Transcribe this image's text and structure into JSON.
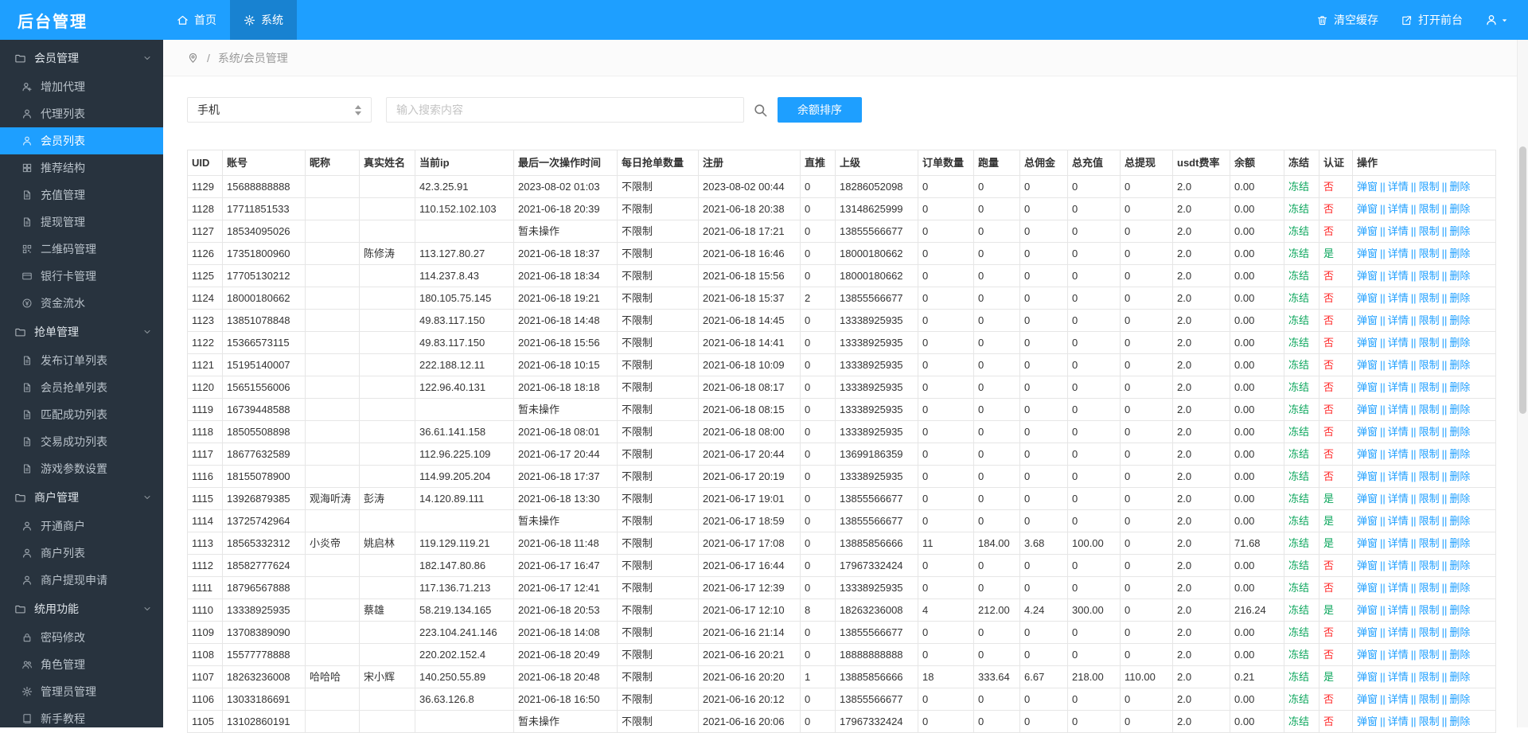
{
  "header": {
    "logo": "后台管理",
    "tabs": [
      {
        "label": "首页",
        "icon": "home",
        "active": false
      },
      {
        "label": "系统",
        "icon": "gear",
        "active": true
      }
    ],
    "actions": [
      {
        "label": "清空缓存",
        "icon": "trash"
      },
      {
        "label": "打开前台",
        "icon": "external"
      }
    ]
  },
  "sidebar": {
    "active_item": "会员列表",
    "sections": [
      {
        "label": "会员管理",
        "items": [
          {
            "label": "增加代理",
            "icon": "person-add"
          },
          {
            "label": "代理列表",
            "icon": "person"
          },
          {
            "label": "会员列表",
            "icon": "person"
          },
          {
            "label": "推荐结构",
            "icon": "grid"
          },
          {
            "label": "充值管理",
            "icon": "doc"
          },
          {
            "label": "提现管理",
            "icon": "doc"
          },
          {
            "label": "二维码管理",
            "icon": "qr"
          },
          {
            "label": "银行卡管理",
            "icon": "card"
          },
          {
            "label": "资金流水",
            "icon": "coin"
          }
        ]
      },
      {
        "label": "抢单管理",
        "items": [
          {
            "label": "发布订单列表",
            "icon": "doc"
          },
          {
            "label": "会员抢单列表",
            "icon": "doc"
          },
          {
            "label": "匹配成功列表",
            "icon": "doc"
          },
          {
            "label": "交易成功列表",
            "icon": "doc"
          },
          {
            "label": "游戏参数设置",
            "icon": "doc"
          }
        ]
      },
      {
        "label": "商户管理",
        "items": [
          {
            "label": "开通商户",
            "icon": "person"
          },
          {
            "label": "商户列表",
            "icon": "person"
          },
          {
            "label": "商户提现申请",
            "icon": "person"
          }
        ]
      },
      {
        "label": "统用功能",
        "items": [
          {
            "label": "密码修改",
            "icon": "lock"
          },
          {
            "label": "角色管理",
            "icon": "users"
          },
          {
            "label": "管理员管理",
            "icon": "gear"
          },
          {
            "label": "新手教程",
            "icon": "book"
          }
        ]
      }
    ]
  },
  "breadcrumb": {
    "separator": "/",
    "path": "系统/会员管理"
  },
  "toolbar": {
    "filter_selected": "手机",
    "search_placeholder": "输入搜索内容",
    "sort_button": "余额排序"
  },
  "table": {
    "columns": [
      "UID",
      "账号",
      "昵称",
      "真实姓名",
      "当前ip",
      "最后一次操作时间",
      "每日抢单数量",
      "注册",
      "直推",
      "上级",
      "订单数量",
      "跑量",
      "总佣金",
      "总充值",
      "总提现",
      "usdt费率",
      "余额",
      "冻结",
      "认证",
      "操作"
    ],
    "freeze_label": "冻结",
    "verified_yes": "是",
    "verified_no": "否",
    "operations": [
      "弹窗",
      "详情",
      "限制",
      "删除"
    ],
    "op_separator": "||",
    "rows": [
      [
        "1129",
        "15688888888",
        "",
        "",
        "42.3.25.91",
        "2023-08-02 01:03",
        "不限制",
        "2023-08-02 00:44",
        "0",
        "18286052098",
        "0",
        "0",
        "0",
        "0",
        "0",
        "2.0",
        "0.00",
        "否"
      ],
      [
        "1128",
        "17711851533",
        "",
        "",
        "110.152.102.103",
        "2021-06-18 20:39",
        "不限制",
        "2021-06-18 20:38",
        "0",
        "13148625999",
        "0",
        "0",
        "0",
        "0",
        "0",
        "2.0",
        "0.00",
        "否"
      ],
      [
        "1127",
        "18534095026",
        "",
        "",
        "",
        "暂未操作",
        "不限制",
        "2021-06-18 17:21",
        "0",
        "13855566677",
        "0",
        "0",
        "0",
        "0",
        "0",
        "2.0",
        "0.00",
        "否"
      ],
      [
        "1126",
        "17351800960",
        "",
        "陈修涛",
        "113.127.80.27",
        "2021-06-18 18:37",
        "不限制",
        "2021-06-18 16:46",
        "0",
        "18000180662",
        "0",
        "0",
        "0",
        "0",
        "0",
        "2.0",
        "0.00",
        "是"
      ],
      [
        "1125",
        "17705130212",
        "",
        "",
        "114.237.8.43",
        "2021-06-18 18:34",
        "不限制",
        "2021-06-18 15:56",
        "0",
        "18000180662",
        "0",
        "0",
        "0",
        "0",
        "0",
        "2.0",
        "0.00",
        "否"
      ],
      [
        "1124",
        "18000180662",
        "",
        "",
        "180.105.75.145",
        "2021-06-18 19:21",
        "不限制",
        "2021-06-18 15:37",
        "2",
        "13855566677",
        "0",
        "0",
        "0",
        "0",
        "0",
        "2.0",
        "0.00",
        "否"
      ],
      [
        "1123",
        "13851078848",
        "",
        "",
        "49.83.117.150",
        "2021-06-18 14:48",
        "不限制",
        "2021-06-18 14:45",
        "0",
        "13338925935",
        "0",
        "0",
        "0",
        "0",
        "0",
        "2.0",
        "0.00",
        "否"
      ],
      [
        "1122",
        "15366573115",
        "",
        "",
        "49.83.117.150",
        "2021-06-18 15:56",
        "不限制",
        "2021-06-18 14:41",
        "0",
        "13338925935",
        "0",
        "0",
        "0",
        "0",
        "0",
        "2.0",
        "0.00",
        "否"
      ],
      [
        "1121",
        "15195140007",
        "",
        "",
        "222.188.12.11",
        "2021-06-18 10:15",
        "不限制",
        "2021-06-18 10:09",
        "0",
        "13338925935",
        "0",
        "0",
        "0",
        "0",
        "0",
        "2.0",
        "0.00",
        "否"
      ],
      [
        "1120",
        "15651556006",
        "",
        "",
        "122.96.40.131",
        "2021-06-18 18:18",
        "不限制",
        "2021-06-18 08:17",
        "0",
        "13338925935",
        "0",
        "0",
        "0",
        "0",
        "0",
        "2.0",
        "0.00",
        "否"
      ],
      [
        "1119",
        "16739448588",
        "",
        "",
        "",
        "暂未操作",
        "不限制",
        "2021-06-18 08:15",
        "0",
        "13338925935",
        "0",
        "0",
        "0",
        "0",
        "0",
        "2.0",
        "0.00",
        "否"
      ],
      [
        "1118",
        "18505508898",
        "",
        "",
        "36.61.141.158",
        "2021-06-18 08:01",
        "不限制",
        "2021-06-18 08:00",
        "0",
        "13338925935",
        "0",
        "0",
        "0",
        "0",
        "0",
        "2.0",
        "0.00",
        "否"
      ],
      [
        "1117",
        "18677632589",
        "",
        "",
        "112.96.225.109",
        "2021-06-17 20:44",
        "不限制",
        "2021-06-17 20:44",
        "0",
        "13699186359",
        "0",
        "0",
        "0",
        "0",
        "0",
        "2.0",
        "0.00",
        "否"
      ],
      [
        "1116",
        "18155078900",
        "",
        "",
        "114.99.205.204",
        "2021-06-18 17:37",
        "不限制",
        "2021-06-17 20:19",
        "0",
        "13338925935",
        "0",
        "0",
        "0",
        "0",
        "0",
        "2.0",
        "0.00",
        "否"
      ],
      [
        "1115",
        "13926879385",
        "观海听涛",
        "彭涛",
        "14.120.89.111",
        "2021-06-18 13:30",
        "不限制",
        "2021-06-17 19:01",
        "0",
        "13855566677",
        "0",
        "0",
        "0",
        "0",
        "0",
        "2.0",
        "0.00",
        "是"
      ],
      [
        "1114",
        "13725742964",
        "",
        "",
        "",
        "暂未操作",
        "不限制",
        "2021-06-17 18:59",
        "0",
        "13855566677",
        "0",
        "0",
        "0",
        "0",
        "0",
        "2.0",
        "0.00",
        "是"
      ],
      [
        "1113",
        "18565332312",
        "小炎帝",
        "姚启林",
        "119.129.119.21",
        "2021-06-18 11:48",
        "不限制",
        "2021-06-17 17:08",
        "0",
        "13885856666",
        "11",
        "184.00",
        "3.68",
        "100.00",
        "0",
        "2.0",
        "71.68",
        "是"
      ],
      [
        "1112",
        "18582777624",
        "",
        "",
        "182.147.80.86",
        "2021-06-17 16:47",
        "不限制",
        "2021-06-17 16:44",
        "0",
        "17967332424",
        "0",
        "0",
        "0",
        "0",
        "0",
        "2.0",
        "0.00",
        "否"
      ],
      [
        "1111",
        "18796567888",
        "",
        "",
        "117.136.71.213",
        "2021-06-17 12:41",
        "不限制",
        "2021-06-17 12:39",
        "0",
        "13338925935",
        "0",
        "0",
        "0",
        "0",
        "0",
        "2.0",
        "0.00",
        "否"
      ],
      [
        "1110",
        "13338925935",
        "",
        "蔡雄",
        "58.219.134.165",
        "2021-06-18 20:53",
        "不限制",
        "2021-06-17 12:10",
        "8",
        "18263236008",
        "4",
        "212.00",
        "4.24",
        "300.00",
        "0",
        "2.0",
        "216.24",
        "是"
      ],
      [
        "1109",
        "13708389090",
        "",
        "",
        "223.104.241.146",
        "2021-06-18 14:08",
        "不限制",
        "2021-06-16 21:14",
        "0",
        "13855566677",
        "0",
        "0",
        "0",
        "0",
        "0",
        "2.0",
        "0.00",
        "否"
      ],
      [
        "1108",
        "15577778888",
        "",
        "",
        "220.202.152.4",
        "2021-06-18 20:49",
        "不限制",
        "2021-06-16 20:21",
        "0",
        "18888888888",
        "0",
        "0",
        "0",
        "0",
        "0",
        "2.0",
        "0.00",
        "否"
      ],
      [
        "1107",
        "18263236008",
        "哈哈哈",
        "宋小辉",
        "140.250.55.89",
        "2021-06-18 20:48",
        "不限制",
        "2021-06-16 20:20",
        "1",
        "13885856666",
        "18",
        "333.64",
        "6.67",
        "218.00",
        "110.00",
        "2.0",
        "0.21",
        "是"
      ],
      [
        "1106",
        "13033186691",
        "",
        "",
        "36.63.126.8",
        "2021-06-18 16:50",
        "不限制",
        "2021-06-16 20:12",
        "0",
        "13855566677",
        "0",
        "0",
        "0",
        "0",
        "0",
        "2.0",
        "0.00",
        "否"
      ],
      [
        "1105",
        "13102860191",
        "",
        "",
        "",
        "暂未操作",
        "不限制",
        "2021-06-16 20:06",
        "0",
        "17967332424",
        "0",
        "0",
        "0",
        "0",
        "0",
        "2.0",
        "0.00",
        "否"
      ]
    ]
  },
  "colors": {
    "accent": "#1E9FFF",
    "sidebar_bg": "#28333E",
    "table_border": "#E6E6E6",
    "green": "#0BA65C",
    "red": "#FF2B2B",
    "link": "#1E9FFF"
  }
}
